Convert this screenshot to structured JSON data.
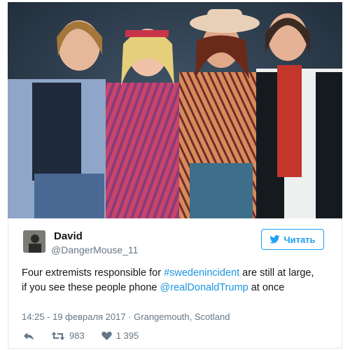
{
  "tweet": {
    "display_name": "David",
    "handle": "@DangerMouse_11",
    "follow_label": "Читать",
    "text": {
      "part1": "Four extremists responsible for ",
      "hashtag": "#swedenincident",
      "part2": " are still at large, if you see these people phone ",
      "mention": "@realDonaldTrump",
      "part3": " at once"
    },
    "meta": "14:25 - 19 февраля 2017 · Grangemouth, Scotland",
    "retweet_count": "983",
    "like_count": "1 395"
  },
  "colors": {
    "accent": "#1da1f2",
    "link": "#1b95e0",
    "secondary_text": "#657786"
  },
  "icons": [
    "twitter-bird-icon",
    "reply-icon",
    "retweet-icon",
    "heart-icon"
  ]
}
